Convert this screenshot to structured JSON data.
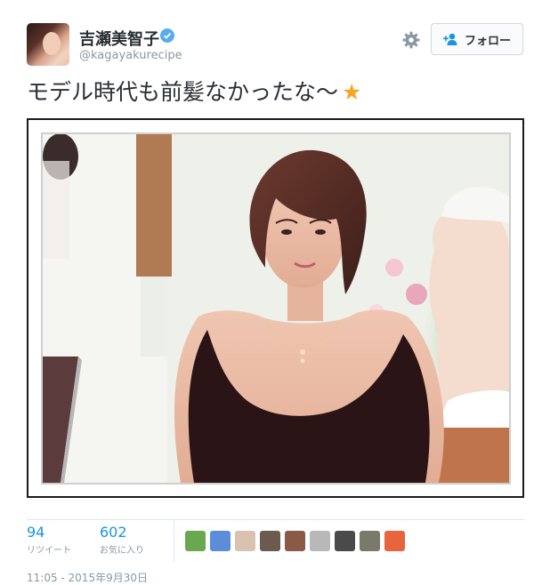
{
  "user": {
    "name": "吉瀬美智子",
    "handle": "@kagayakurecipe",
    "verified_icon": "verified-badge-icon"
  },
  "actions": {
    "settings_icon": "gear-icon",
    "follow_label": "フォロー",
    "follow_icon": "add-person-icon"
  },
  "tweet": {
    "text": "モデル時代も前髪なかったな〜",
    "emoji": "★"
  },
  "stats": {
    "retweets_count": "94",
    "retweets_label": "リツイート",
    "favorites_count": "602",
    "favorites_label": "お気に入り"
  },
  "favoriters": [
    {
      "icon": "user-avatar-1",
      "color": "#6aa84f"
    },
    {
      "icon": "user-avatar-2",
      "color": "#5b8dd9"
    },
    {
      "icon": "user-avatar-3",
      "color": "#d9c3b0"
    },
    {
      "icon": "user-avatar-4",
      "color": "#6b5a4e"
    },
    {
      "icon": "user-avatar-5",
      "color": "#8a5a46"
    },
    {
      "icon": "user-avatar-6",
      "color": "#b8b8b8"
    },
    {
      "icon": "user-avatar-7",
      "color": "#4a4a4a"
    },
    {
      "icon": "user-avatar-8",
      "color": "#7a7a6a"
    },
    {
      "icon": "user-avatar-9",
      "color": "#e8643c"
    }
  ],
  "timestamp": "11:05 - 2015年9月30日",
  "colors": {
    "accent": "#1b95e0",
    "text": "#292f33",
    "muted": "#8899a6",
    "verified": "#55acee",
    "star": "#f5a623"
  }
}
